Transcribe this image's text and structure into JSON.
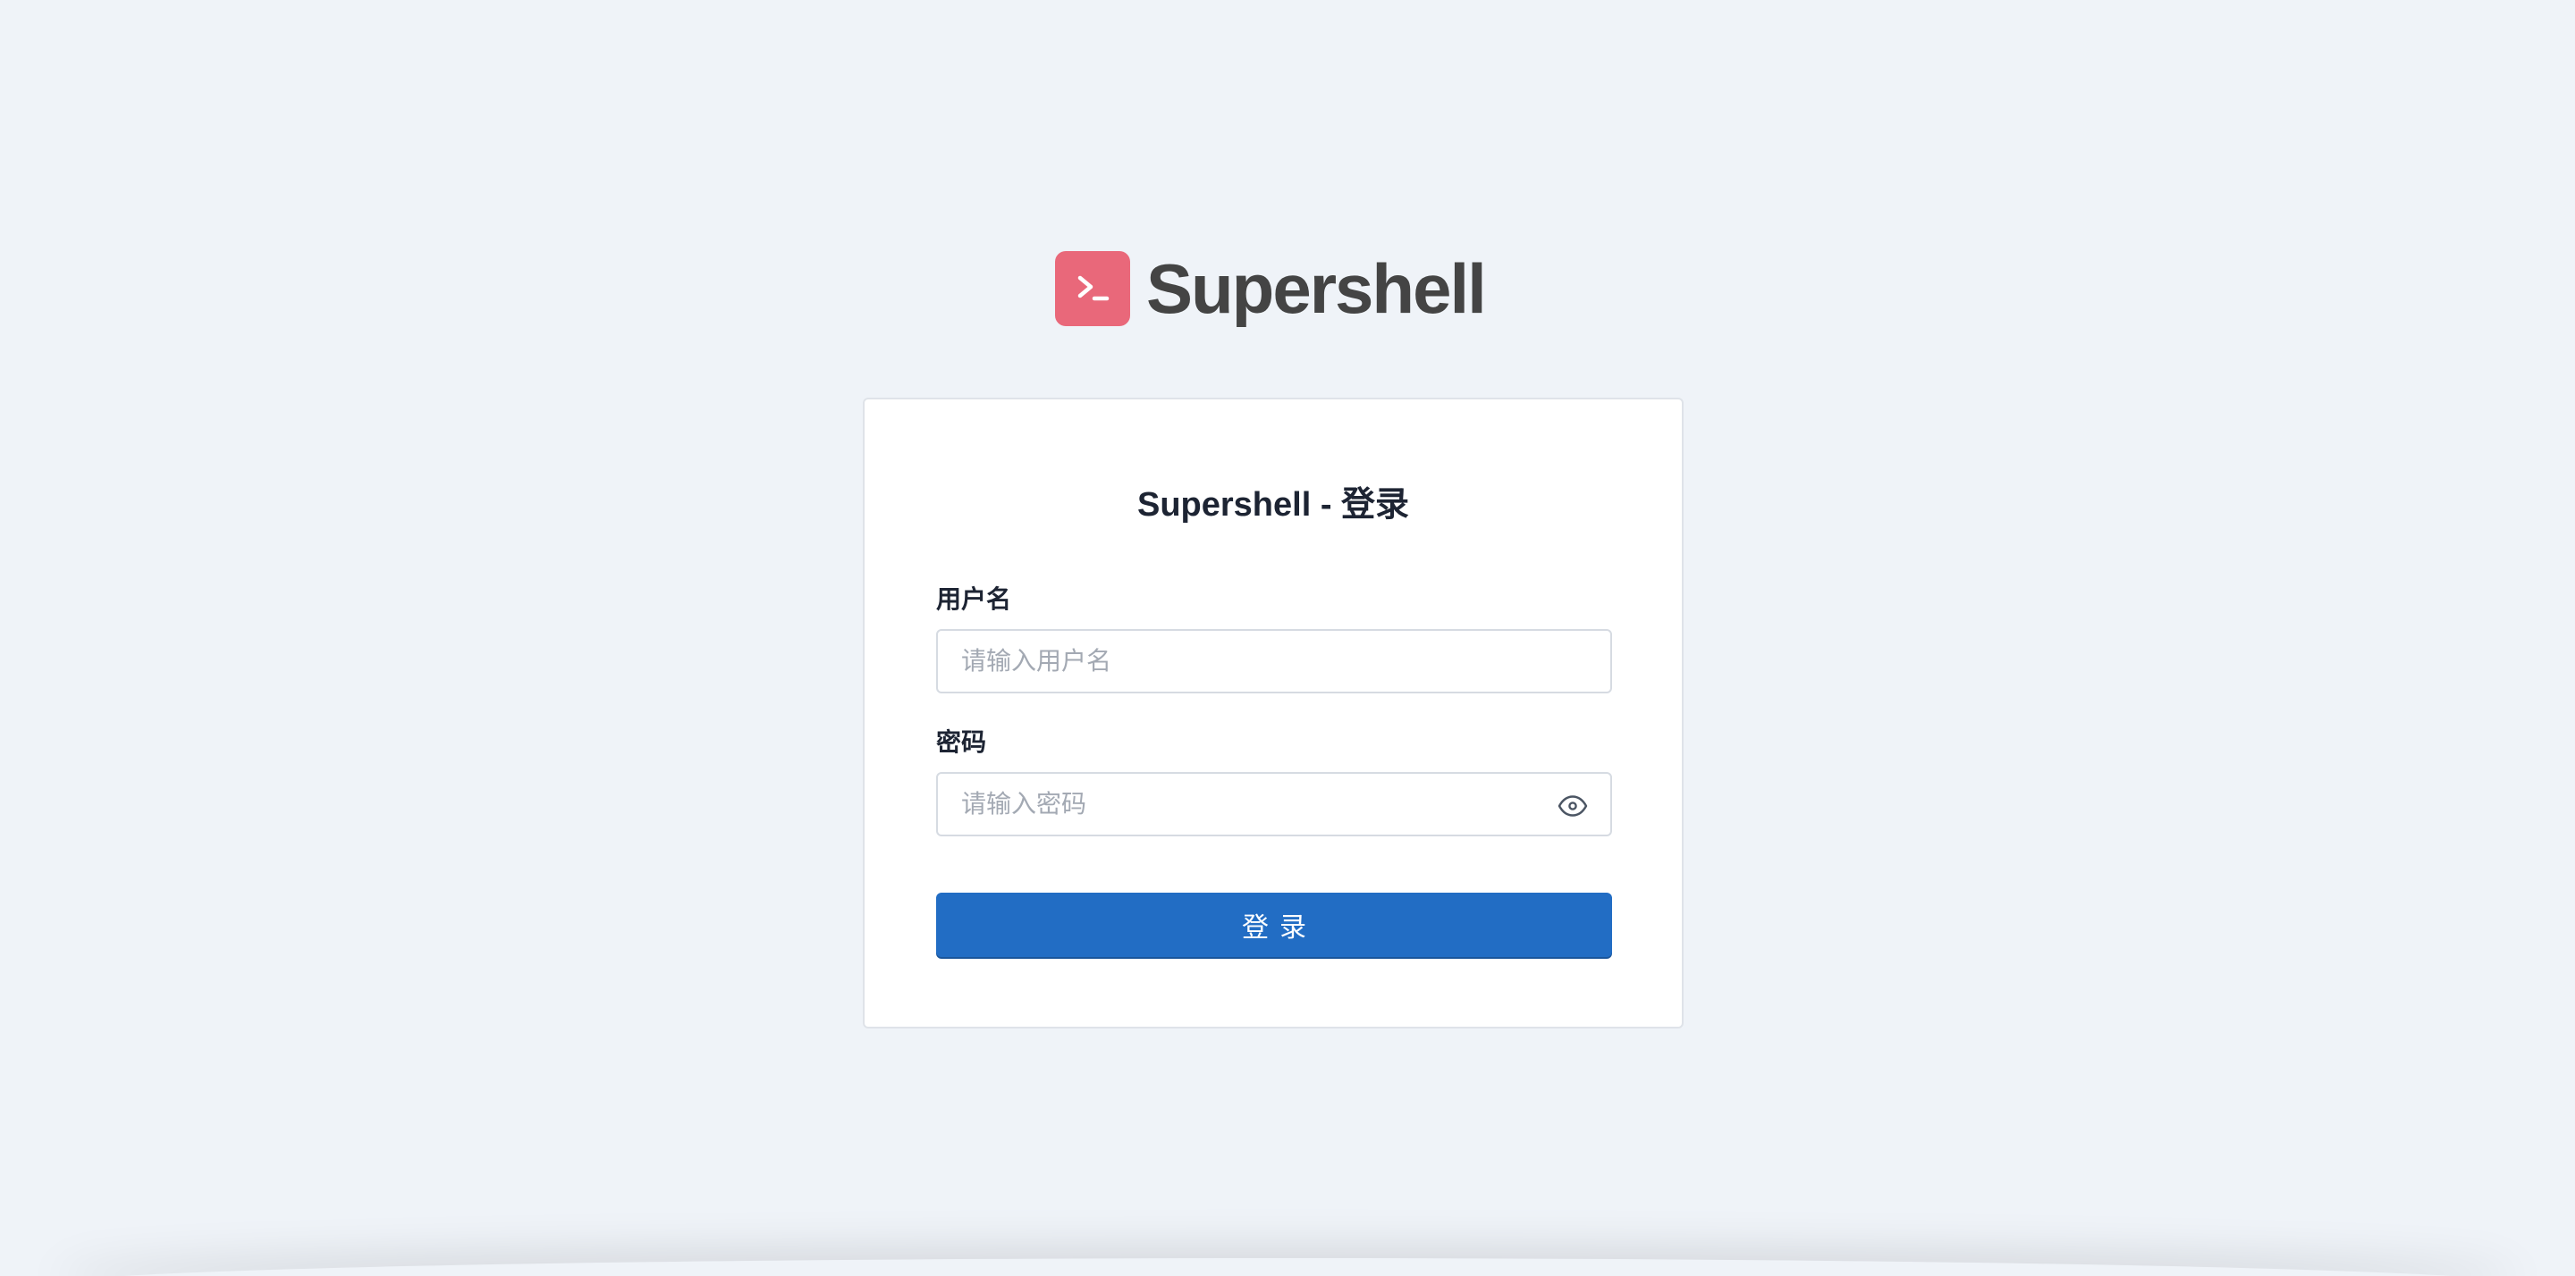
{
  "brand": {
    "name": "Supershell",
    "logo_icon": "terminal-prompt-icon",
    "logo_color": "#e9687a"
  },
  "login_card": {
    "title": "Supershell - 登录",
    "username": {
      "label": "用户名",
      "placeholder": "请输入用户名",
      "value": ""
    },
    "password": {
      "label": "密码",
      "placeholder": "请输入密码",
      "value": "",
      "toggle_icon": "eye-icon"
    },
    "submit_label": "登录"
  },
  "colors": {
    "background": "#eff3f8",
    "primary": "#226dc4",
    "title_text": "#1d2433"
  }
}
